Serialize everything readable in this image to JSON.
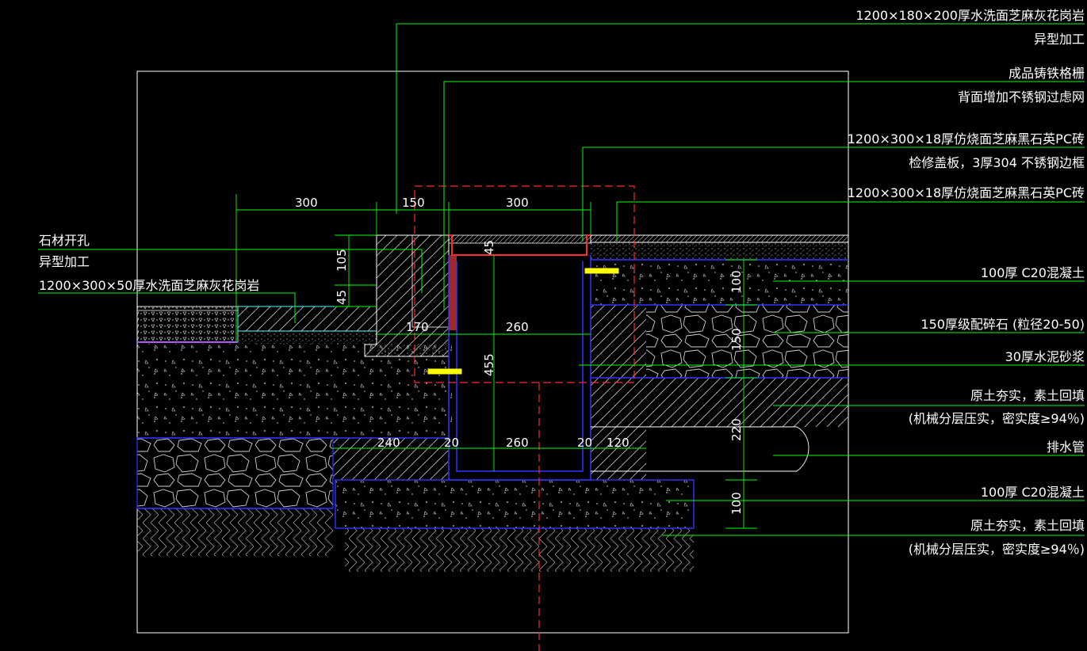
{
  "colors": {
    "background": "#000000",
    "leader": "#00ff00",
    "outline": "#ffffff",
    "layer_boundary": "#3333ff",
    "section_mark": "#ff2a2a",
    "bolt": "#ffff00",
    "hatch": "#bfbfbf"
  },
  "labels_right": {
    "l1a": "1200×180×200厚水洗面芝麻灰花岗岩",
    "l1b": "异型加工",
    "l2a": "成品铸铁格栅",
    "l2b": "背面增加不锈钢过虑网",
    "l3a": "1200×300×18厚仿烧面芝麻黑石英PC砖",
    "l3b": "检修盖板，3厚304 不锈钢边框",
    "l4": "1200×300×18厚仿烧面芝麻黑石英PC砖",
    "l5": "100厚  C20混凝土",
    "l6": "150厚级配碎石 (粒径20-50)",
    "l7": "30厚水泥砂浆",
    "l8a": "原土夯实，素土回填",
    "l8b": "(机械分层压实，密实度≥94％)",
    "l9": "排水管",
    "l10": "100厚  C20混凝土",
    "l11a": "原土夯实，素土回填",
    "l11b": "(机械分层压实，密实度≥94％)"
  },
  "labels_left": {
    "a": "石材开孔",
    "b": "异型加工",
    "c": "1200×300×50厚水洗面芝麻灰花岗岩"
  },
  "dimensions": {
    "top_300a": "300",
    "top_150": "150",
    "top_300b": "300",
    "v_105": "105",
    "v_45a": "45",
    "v_45b": "45",
    "mid_170": "170",
    "mid_260": "260",
    "v_455": "455",
    "bot_240": "240",
    "bot_20a": "20",
    "bot_260": "260",
    "bot_20b": "20",
    "bot_120": "120",
    "r_100a": "100",
    "r_150": "150",
    "r_220": "220",
    "r_100b": "100"
  }
}
